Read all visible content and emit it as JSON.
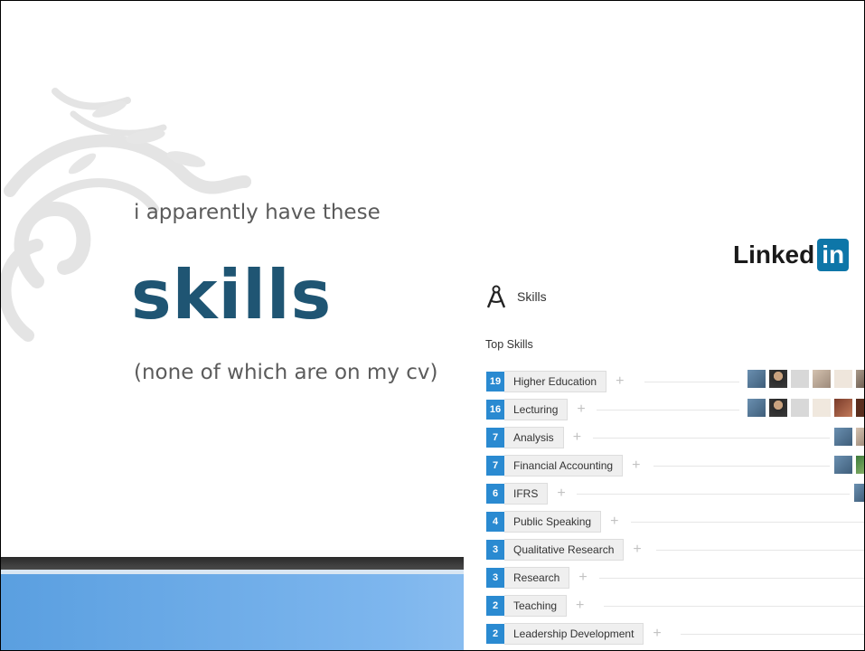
{
  "slide": {
    "subtitle": "i apparently have these",
    "headline": "skills",
    "note": "(none of which are on my cv)"
  },
  "linkedin": {
    "logo_word": "Linked",
    "logo_badge": "in",
    "section_title": "Skills",
    "top_skills_label": "Top Skills",
    "skills": [
      {
        "count": "19",
        "name": "Higher Education"
      },
      {
        "count": "16",
        "name": "Lecturing"
      },
      {
        "count": "7",
        "name": "Analysis"
      },
      {
        "count": "7",
        "name": "Financial Accounting"
      },
      {
        "count": "6",
        "name": "IFRS"
      },
      {
        "count": "4",
        "name": "Public Speaking"
      },
      {
        "count": "3",
        "name": "Qualitative Research"
      },
      {
        "count": "3",
        "name": "Research"
      },
      {
        "count": "2",
        "name": "Teaching"
      },
      {
        "count": "2",
        "name": "Leadership Development"
      }
    ],
    "plus_glyph": "+"
  },
  "colors": {
    "headline": "#1f5573",
    "count_badge": "#2a8ad1",
    "linkedin_blue": "#0e76a8"
  }
}
